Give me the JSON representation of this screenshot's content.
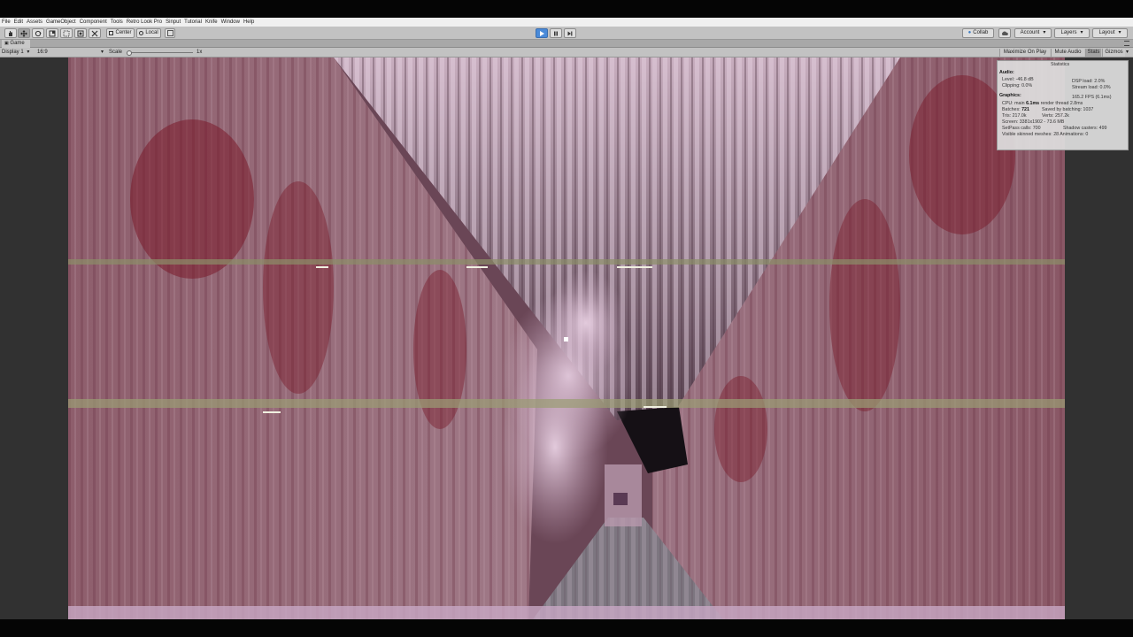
{
  "menu": [
    "File",
    "Edit",
    "Assets",
    "GameObject",
    "Component",
    "Tools",
    "Retro Look Pro",
    "Sinput",
    "Tutorial",
    "Knife",
    "Window",
    "Help"
  ],
  "toolbar": {
    "tools": [
      "hand-tool-icon",
      "move-tool-icon",
      "rotate-tool-icon",
      "scale-tool-icon",
      "rect-tool-icon",
      "transform-tool-icon",
      "custom-tool-icon"
    ],
    "pivot": "Center",
    "space": "Local",
    "collab": "Collab",
    "account": "Account",
    "layers": "Layers",
    "layout": "Layout",
    "play_icons": [
      "play-icon",
      "pause-icon",
      "step-icon"
    ]
  },
  "game_tab": {
    "label": "Game"
  },
  "game_bar": {
    "display": "Display 1",
    "aspect": "16:9",
    "scale_label": "Scale",
    "scale_value": "1x",
    "maximize_on_play": "Maximize On Play",
    "mute_audio": "Mute Audio",
    "stats": "Stats",
    "gizmos": "Gizmos"
  },
  "statistics": {
    "title": "Statistics",
    "audio_label": "Audio:",
    "level": "Level: -46.8 dB",
    "clipping": "Clipping: 0.0%",
    "dsp_load": "DSP load: 2.0%",
    "stream_load": "Stream load: 0.0%",
    "graphics_label": "Graphics:",
    "fps": "165.2 FPS (6.1ms)",
    "cpu_prefix": "CPU: main",
    "cpu_main": "6.1ms",
    "render_thread": "render thread 2.8ms",
    "batches_label": "Batches:",
    "batches": "721",
    "saved_by_batching": "Saved by batching: 1037",
    "tris": "Tris: 217.0k",
    "verts": "Verts: 257.2k",
    "screen": "Screen: 3381x1902 - 73.6 MB",
    "setpass": "SetPass calls: 700",
    "shadow_casters": "Shadow casters: 499",
    "skinned": "Visible skinned meshes: 28  Animations: 0"
  },
  "colors": {
    "wall": "#8c5a68",
    "blood": "#7a1a2a",
    "ceiling": "#b89aac",
    "accent_play": "#4a8ad8"
  }
}
